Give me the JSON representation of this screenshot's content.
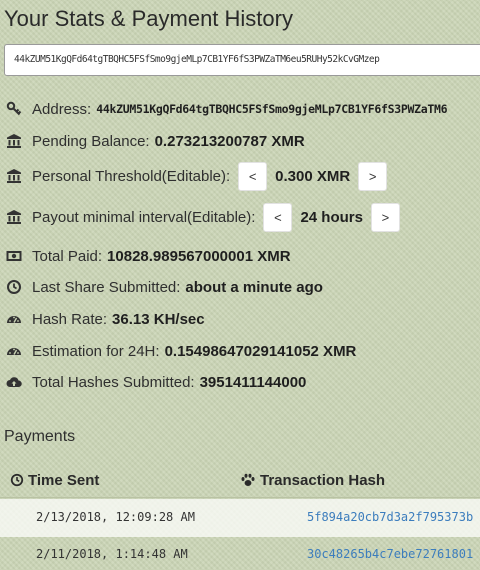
{
  "page": {
    "title": "Your Stats & Payment History",
    "address_value": "44kZUM51KgQFd64tgTBQHC5FSfSmo9gjeMLp7CB1YF6fS3PWZaTM6eu5RUHy52kCvGMzep"
  },
  "stats": {
    "address": {
      "label": "Address:",
      "value": "44kZUM51KgQFd64tgTBQHC5FSfSmo9gjeMLp7CB1YF6fS3PWZaTM6",
      "icon": "key-icon"
    },
    "pending": {
      "label": "Pending Balance:",
      "value": "0.273213200787 XMR",
      "icon": "bank-icon"
    },
    "threshold": {
      "label": "Personal Threshold(Editable):",
      "value": "0.300 XMR",
      "dec": "<",
      "inc": ">",
      "icon": "bank-icon"
    },
    "payout_interval": {
      "label": "Payout minimal interval(Editable):",
      "value": "24 hours",
      "dec": "<",
      "inc": ">",
      "icon": "bank-icon"
    },
    "total_paid": {
      "label": "Total Paid:",
      "value": "10828.989567000001 XMR",
      "icon": "money-icon"
    },
    "last_share": {
      "label": "Last Share Submitted:",
      "value": "about a minute ago",
      "icon": "clock-icon"
    },
    "hash_rate": {
      "label": "Hash Rate:",
      "value": "36.13 KH/sec",
      "icon": "dashboard-icon"
    },
    "estimation": {
      "label": "Estimation for 24H:",
      "value": "0.15498647029141052 XMR",
      "icon": "dashboard-icon"
    },
    "total_hashes": {
      "label": "Total Hashes Submitted:",
      "value": "3951411144000",
      "icon": "cloud-upload-icon"
    }
  },
  "payments": {
    "heading": "Payments",
    "columns": {
      "time_sent": "Time Sent",
      "tx_hash": "Transaction Hash"
    },
    "rows": [
      {
        "time": "2/13/2018, 12:09:28 AM",
        "hash": "5f894a20cb7d3a2f795373b"
      },
      {
        "time": "2/11/2018, 1:14:48 AM",
        "hash": "30c48265b4c7ebe72761801"
      }
    ]
  },
  "colors": {
    "background": "#c9d3b4",
    "link": "#3c7dbd",
    "text": "#2b2b2b"
  }
}
